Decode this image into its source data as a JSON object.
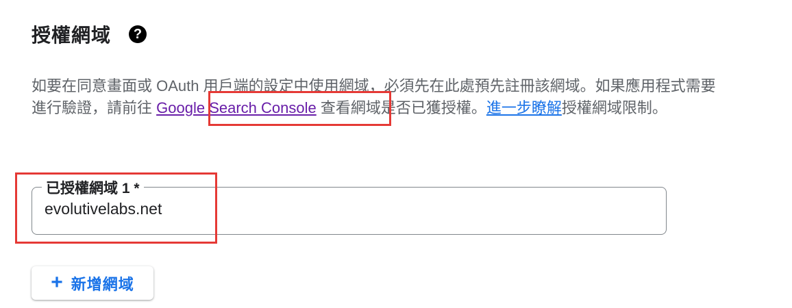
{
  "section": {
    "title": "授權網域",
    "help_icon": "?"
  },
  "description": {
    "text_before_link": "如要在同意畫面或 OAuth 用戶端的設定中使用網域，必須先在此處預先註冊該網域。如果應用程式需要進行驗證，請前往",
    "gsc_link": "Google Search Console",
    "text_between": "查看網域是否已獲授權。",
    "learn_more_link": "進一步瞭解",
    "text_after": "授權網域限制。"
  },
  "authorized_domain_field": {
    "label": "已授權網域 1 *",
    "value": "evolutivelabs.net"
  },
  "add_domain_button": {
    "icon": "+",
    "label": "新增網域"
  },
  "colors": {
    "link_visited": "#681da8",
    "link_primary": "#1a73e8",
    "highlight_box": "#e53935"
  }
}
